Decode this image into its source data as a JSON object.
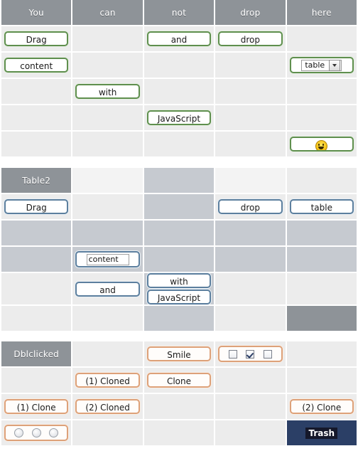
{
  "colors": {
    "header_gray": "#8e9398",
    "cell_light": "#ececec",
    "cell_mid": "#c6cad0",
    "green_border": "#5f8f4e",
    "blue_border": "#5c7f9e",
    "orange_border": "#dda179",
    "trash_navy": "#2b3f66"
  },
  "table1": {
    "name": "Table1",
    "headers": [
      "You",
      "can",
      "not",
      "drop",
      "here"
    ],
    "items": {
      "drag": "Drag",
      "and": "and",
      "drop": "drop",
      "content": "content",
      "with": "with",
      "javascript": "JavaScript",
      "select_value": "table",
      "smiley_icon": "smiley-face-icon"
    }
  },
  "table2": {
    "name": "Table2",
    "title": "Table2",
    "items": {
      "drag": "Drag",
      "drop": "drop",
      "table": "table",
      "content_input_value": "content",
      "and": "and",
      "with": "with",
      "javascript": "JavaScript"
    }
  },
  "table3": {
    "name": "Table3",
    "title": "Dblclicked",
    "items": {
      "smile": "Smile",
      "clone": "Clone",
      "cloned_1": "(1) Cloned",
      "cloned_2": "(2) Cloned",
      "clone_1": "(1) Clone",
      "clone_2": "(2) Clone",
      "trash": "Trash"
    },
    "checkboxes": [
      {
        "name": "checkbox-1",
        "checked": false
      },
      {
        "name": "checkbox-2",
        "checked": true
      },
      {
        "name": "checkbox-3",
        "checked": false
      }
    ],
    "radios": [
      {
        "name": "radio-1",
        "checked": false
      },
      {
        "name": "radio-2",
        "checked": false
      },
      {
        "name": "radio-3",
        "checked": false
      }
    ]
  }
}
